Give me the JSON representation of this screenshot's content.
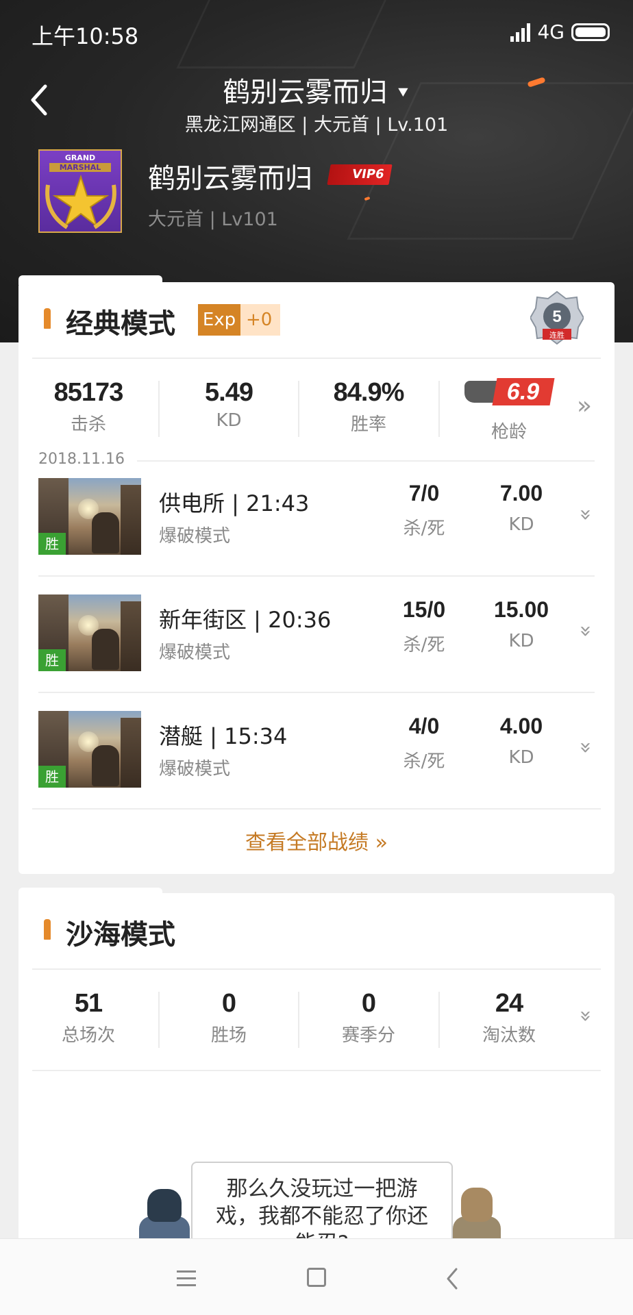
{
  "status_bar": {
    "time": "上午10:58",
    "network": "4G"
  },
  "header": {
    "title": "鹤别云雾而归",
    "subtitle": "黑龙江网通区 | 大元首 | Lv.101"
  },
  "profile": {
    "avatar_text_1": "GRAND",
    "avatar_text_2": "MARSHAL",
    "name": "鹤别云雾而归",
    "vip": "VIP6",
    "sub": "大元首 | Lv101"
  },
  "classic": {
    "title": "经典模式",
    "exp_label": "Exp",
    "exp_value": "+0",
    "streak_badge": "5",
    "streak_label": "连胜",
    "stats": [
      {
        "value": "85173",
        "label": "击杀"
      },
      {
        "value": "5.49",
        "label": "KD"
      },
      {
        "value": "84.9%",
        "label": "胜率"
      }
    ],
    "gun_age_value": "6.9",
    "gun_age_label": "枪龄",
    "date": "2018.11.16",
    "matches": [
      {
        "title": "供电所 | 21:43",
        "mode": "爆破模式",
        "result": "胜",
        "kills_deaths": "7/0",
        "kd_label": "杀/死",
        "kd": "7.00",
        "kd_unit": "KD"
      },
      {
        "title": "新年街区 | 20:36",
        "mode": "爆破模式",
        "result": "胜",
        "kills_deaths": "15/0",
        "kd_label": "杀/死",
        "kd": "15.00",
        "kd_unit": "KD"
      },
      {
        "title": "潜艇 | 15:34",
        "mode": "爆破模式",
        "result": "胜",
        "kills_deaths": "4/0",
        "kd_label": "杀/死",
        "kd": "4.00",
        "kd_unit": "KD"
      }
    ],
    "view_all": "查看全部战绩 »"
  },
  "desert": {
    "title": "沙海模式",
    "stats": [
      {
        "value": "51",
        "label": "总场次"
      },
      {
        "value": "0",
        "label": "胜场"
      },
      {
        "value": "0",
        "label": "赛季分"
      },
      {
        "value": "24",
        "label": "淘汰数"
      }
    ],
    "tip": "那么久没玩过一把游戏，我都不能忍了你还能忍?"
  },
  "colors": {
    "accent": "#d58425",
    "link": "#c57a24",
    "win": "#3aa133",
    "vip": "#e02424"
  }
}
